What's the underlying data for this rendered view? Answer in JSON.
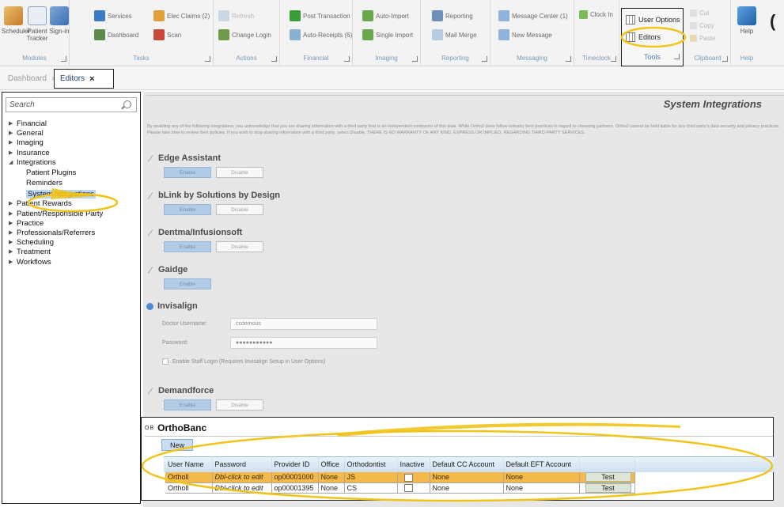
{
  "ribbon": {
    "modules": {
      "label": "Modules",
      "buttons": [
        "Scheduler",
        "Patient Tracker",
        "Sign-in"
      ]
    },
    "tasks": {
      "label": "Tasks",
      "buttons": [
        "Services",
        "Elec Claims (2)",
        "Dashboard",
        "Scan"
      ]
    },
    "actions": {
      "label": "Actions",
      "buttons": [
        "Refresh",
        "Change Login"
      ]
    },
    "financial": {
      "label": "Financial",
      "buttons": [
        "Post Transaction",
        "Auto-Receipts (6)"
      ]
    },
    "imaging": {
      "label": "Imaging",
      "buttons": [
        "Auto-Import",
        "Single Import"
      ]
    },
    "reporting": {
      "label": "Reporting",
      "buttons": [
        "Reporting",
        "Mail Merge"
      ]
    },
    "messaging": {
      "label": "Messaging",
      "buttons": [
        "Message Center (1)",
        "New Message"
      ]
    },
    "timeclock": {
      "label": "Timeclock",
      "buttons": [
        "Clock In"
      ]
    },
    "tools": {
      "label": "Tools",
      "user_options": "User Options",
      "editors": "Editors"
    },
    "clipboard": {
      "label": "Clipboard",
      "buttons": [
        "Cut",
        "Copy",
        "Paste"
      ]
    },
    "help": {
      "label": "Help",
      "buttons": [
        "Help"
      ]
    }
  },
  "tabs": [
    {
      "label": "Dashboard"
    },
    {
      "label": "Editors"
    }
  ],
  "sidebar": {
    "search_placeholder": "Search",
    "tree": [
      {
        "label": "Financial"
      },
      {
        "label": "General"
      },
      {
        "label": "Imaging"
      },
      {
        "label": "Insurance"
      },
      {
        "label": "Integrations"
      },
      {
        "label": "Patient Rewards"
      },
      {
        "label": "Patient/Responsible Party"
      },
      {
        "label": "Practice"
      },
      {
        "label": "Professionals/Referrers"
      },
      {
        "label": "Scheduling"
      },
      {
        "label": "Treatment"
      },
      {
        "label": "Workflows"
      }
    ],
    "integrations_children": [
      {
        "label": "Patient Plugins"
      },
      {
        "label": "Reminders"
      },
      {
        "label": "System Integrations"
      }
    ]
  },
  "content": {
    "title": "System Integrations",
    "disclaimer": "By enabling any of the following integrations, you acknowledge that you are sharing information with a third party that is an independent contractor of this data. While Ortho2 does follow industry best practices in regard to choosing partners, Ortho2 cannot be held liable for any third party's data security and privacy practices. Please take time to review their policies. If you wish to stop sharing information with a third party, select Disable. THERE IS NO WARRANTY OF ANY KIND, EXPRESS OR IMPLIED, REGARDING THIRD PARTY SERVICES.",
    "enable_label": "Enable",
    "disable_label": "Disable",
    "sections": {
      "edge": "Edge Assistant",
      "blink": "bLink by Solutions by Design",
      "dentma": "Dentma/Infusionsoft",
      "gaidge": "Gaidge",
      "invisalign": "Invisalign",
      "demandforce": "Demandforce"
    },
    "invisalign": {
      "doctor_username_label": "Doctor Username:",
      "doctor_username_value": "ccdemous",
      "password_label": "Password:",
      "password_value": "●●●●●●●●●●●",
      "staff_login_label": "Enable Staff Login (Requires Invisalign Setup in User Options)"
    }
  },
  "orthobanc": {
    "prefix": "OB",
    "title": "OrthoBanc",
    "new_label": "New",
    "columns": [
      "User Name",
      "Password",
      "Provider ID",
      "Office",
      "Orthodontist",
      "Inactive",
      "Default CC Account",
      "Default EFT Account",
      ""
    ],
    "rows": [
      {
        "user": "Ortholl",
        "password": "Dbl-click to edit",
        "provider": "op00001000",
        "office": "None",
        "ortho": "JS",
        "cc": "None",
        "eft": "None",
        "test": "Test"
      },
      {
        "user": "Ortholl",
        "password": "Dbl-click to edit",
        "provider": "op00001395",
        "office": "None",
        "ortho": "CS",
        "cc": "None",
        "eft": "None",
        "test": "Test"
      }
    ]
  },
  "colors": {
    "accent": "#f0c419",
    "selection": "#bcd5f0",
    "row_highlight": "#f5b84a"
  }
}
